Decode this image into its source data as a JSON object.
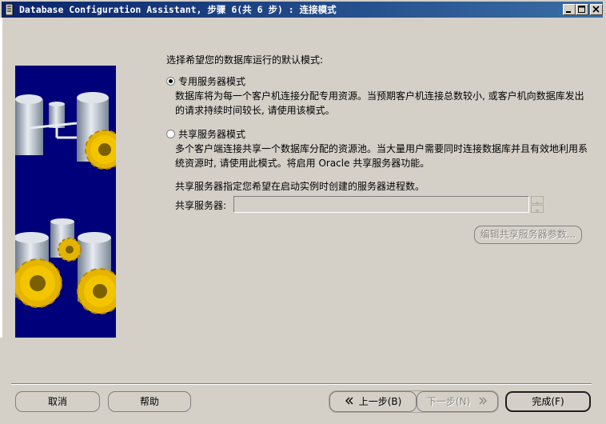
{
  "window": {
    "title": "Database Configuration Assistant, 步骤 6(共 6 步) : 连接模式"
  },
  "content": {
    "prompt": "选择希望您的数据库运行的默认模式:",
    "dedicated": {
      "label": "专用服务器模式",
      "selected": true,
      "description": "数据库将为每一个客户机连接分配专用资源。当预期客户机连接总数较小, 或客户机向数据库发出的请求持续时间较长, 请使用该模式。"
    },
    "shared": {
      "label": "共享服务器模式",
      "selected": false,
      "description": "多个客户端连接共享一个数据库分配的资源池。当大量用户需要同时连接数据库并且有效地利用系统资源时, 请使用此模式。将启用 Oracle 共享服务器功能。",
      "hint": "共享服务器指定您希望在启动实例时创建的服务器进程数。",
      "field_label": "共享服务器:",
      "field_value": "",
      "edit_button": "编辑共享服务器参数..."
    }
  },
  "buttons": {
    "cancel": "取消",
    "help": "帮助",
    "back": "上一步(B)",
    "next": "下一步(N)",
    "finish": "完成(F)"
  },
  "icons": {
    "back": "double-chevron-left-icon",
    "next": "double-chevron-right-icon"
  }
}
